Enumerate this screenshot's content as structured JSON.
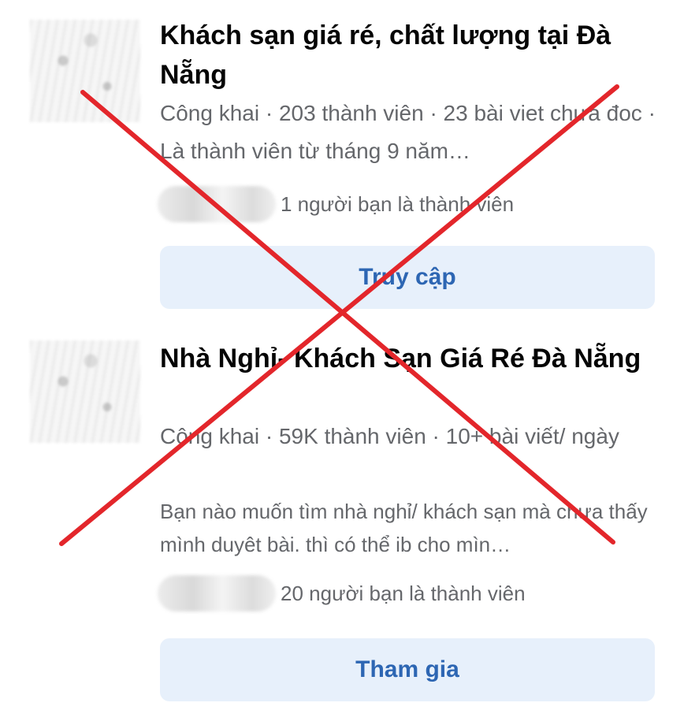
{
  "groups": [
    {
      "title": "Khách sạn giá ré, chất lượng tại Đà Nẵng",
      "meta": "Công khai · 203 thành viên · 23 bài viet chưa đoc · Là thành viên từ tháng 9 năm…",
      "description": "",
      "friends": "1 người bạn là thành viên",
      "button": "Truy cập"
    },
    {
      "title": "Nhà Nghỉ- Khách Sạn Giá Ré Đà Nẵng",
      "meta": "Công khai · 59K thành viên · 10+ bài viết/ ngày",
      "description": "Bạn nào muốn tìm nhà nghỉ/ khách sạn mà chưa thấy mình duyêt bài. thì có thể ib cho mìn…",
      "friends": "20 người bạn là thành viên",
      "button": "Tham gia"
    }
  ],
  "colors": {
    "button_bg": "#e7f0fb",
    "button_text": "#2d66b3",
    "title": "#050505",
    "secondary": "#65676b",
    "cross": "#e3262b"
  },
  "icons": [
    "group-thumbnail",
    "friend-avatars",
    "red-cross-mark"
  ]
}
